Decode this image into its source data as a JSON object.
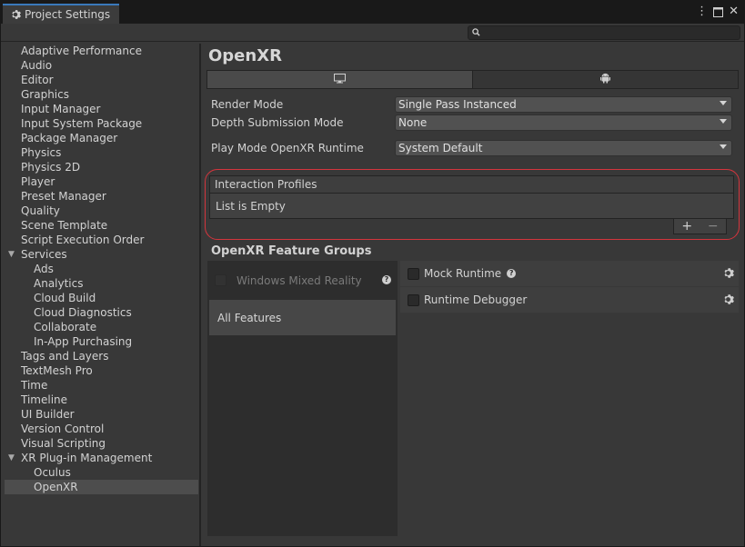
{
  "window": {
    "tab_title": "Project Settings",
    "menu_icon": "kebab-menu-icon",
    "maximize_icon": "maximize-icon",
    "close_icon": "close-icon",
    "close_glyph": "✕",
    "menu_glyph": "⋮"
  },
  "search": {
    "value": "",
    "placeholder": ""
  },
  "sidebar": {
    "items": [
      {
        "label": "Adaptive Performance"
      },
      {
        "label": "Audio"
      },
      {
        "label": "Editor"
      },
      {
        "label": "Graphics"
      },
      {
        "label": "Input Manager"
      },
      {
        "label": "Input System Package"
      },
      {
        "label": "Package Manager"
      },
      {
        "label": "Physics"
      },
      {
        "label": "Physics 2D"
      },
      {
        "label": "Player"
      },
      {
        "label": "Preset Manager"
      },
      {
        "label": "Quality"
      },
      {
        "label": "Scene Template"
      },
      {
        "label": "Script Execution Order"
      },
      {
        "label": "Services"
      },
      {
        "label": "Ads"
      },
      {
        "label": "Analytics"
      },
      {
        "label": "Cloud Build"
      },
      {
        "label": "Cloud Diagnostics"
      },
      {
        "label": "Collaborate"
      },
      {
        "label": "In-App Purchasing"
      },
      {
        "label": "Tags and Layers"
      },
      {
        "label": "TextMesh Pro"
      },
      {
        "label": "Time"
      },
      {
        "label": "Timeline"
      },
      {
        "label": "UI Builder"
      },
      {
        "label": "Version Control"
      },
      {
        "label": "Visual Scripting"
      },
      {
        "label": "XR Plug-in Management"
      },
      {
        "label": "Oculus"
      },
      {
        "label": "OpenXR"
      }
    ],
    "selected": "OpenXR"
  },
  "main": {
    "title": "OpenXR",
    "platform_tabs": [
      {
        "icon": "desktop-monitor-icon",
        "active": true
      },
      {
        "icon": "android-icon",
        "active": false
      }
    ],
    "fields": {
      "render_mode": {
        "label": "Render Mode",
        "value": "Single Pass Instanced"
      },
      "depth_submission": {
        "label": "Depth Submission Mode",
        "value": "None"
      },
      "play_mode_runtime": {
        "label": "Play Mode OpenXR Runtime",
        "value": "System Default"
      }
    },
    "interaction_profiles": {
      "header": "Interaction Profiles",
      "empty_text": "List is Empty",
      "add_label": "+",
      "remove_label": "−",
      "highlight_color": "#d4353d"
    },
    "feature_groups": {
      "title": "OpenXR Feature Groups",
      "groups": [
        {
          "label": "Windows Mixed Reality",
          "enabled": false
        },
        {
          "label": "All Features",
          "selected": true
        }
      ],
      "help_glyph": "?",
      "features": [
        {
          "label": "Mock Runtime",
          "checked": false,
          "has_help": true
        },
        {
          "label": "Runtime Debugger",
          "checked": false,
          "has_help": false
        }
      ]
    }
  },
  "colors": {
    "accent_tab": "#3a79bb",
    "panel_bg": "#383838",
    "dark_bg": "#191919"
  }
}
